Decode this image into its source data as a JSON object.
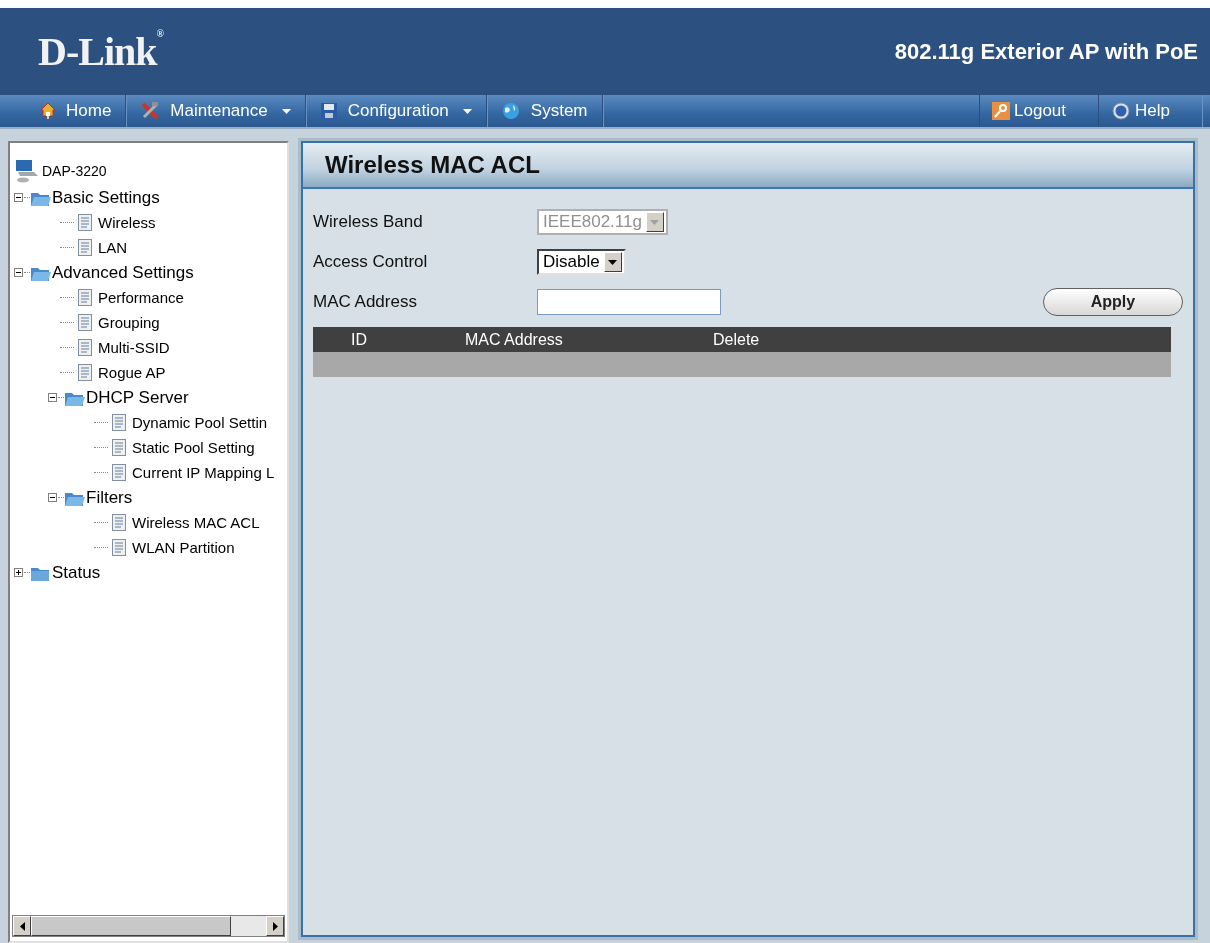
{
  "header": {
    "logo": "D-Link",
    "registered": "®",
    "product": "802.11g Exterior AP with PoE"
  },
  "nav": {
    "left": [
      {
        "label": "Home",
        "dropdown": false
      },
      {
        "label": "Maintenance",
        "dropdown": true
      },
      {
        "label": "Configuration",
        "dropdown": true
      },
      {
        "label": "System",
        "dropdown": false
      }
    ],
    "right": [
      {
        "label": "Logout",
        "dropdown": false
      },
      {
        "label": "Help",
        "dropdown": false
      }
    ]
  },
  "tree": {
    "label": "DAP-3220",
    "children": [
      {
        "label": "Basic Settings",
        "kind": "folder",
        "expanded": true,
        "children": [
          {
            "label": "Wireless",
            "kind": "page"
          },
          {
            "label": "LAN",
            "kind": "page"
          }
        ]
      },
      {
        "label": "Advanced Settings",
        "kind": "folder",
        "expanded": true,
        "children": [
          {
            "label": "Performance",
            "kind": "page"
          },
          {
            "label": "Grouping",
            "kind": "page"
          },
          {
            "label": "Multi-SSID",
            "kind": "page"
          },
          {
            "label": "Rogue AP",
            "kind": "page"
          },
          {
            "label": "DHCP Server",
            "kind": "folder",
            "expanded": true,
            "children": [
              {
                "label": "Dynamic Pool Settin",
                "kind": "page"
              },
              {
                "label": "Static Pool Setting",
                "kind": "page"
              },
              {
                "label": "Current IP Mapping L",
                "kind": "page"
              }
            ]
          },
          {
            "label": "Filters",
            "kind": "folder",
            "expanded": true,
            "children": [
              {
                "label": "Wireless MAC ACL",
                "kind": "page"
              },
              {
                "label": "WLAN Partition",
                "kind": "page"
              }
            ]
          }
        ]
      },
      {
        "label": "Status",
        "kind": "folder",
        "expanded": false
      }
    ]
  },
  "panel": {
    "title": "Wireless MAC ACL",
    "fields": [
      {
        "label": "Wireless Band",
        "kind": "select",
        "value": "IEEE802.11g",
        "disabled": true
      },
      {
        "label": "Access Control",
        "kind": "select",
        "value": "Disable",
        "disabled": false
      },
      {
        "label": "MAC Address",
        "kind": "text"
      }
    ],
    "apply": "Apply",
    "table": {
      "columns": [
        "ID",
        "MAC Address",
        "Delete"
      ]
    }
  }
}
